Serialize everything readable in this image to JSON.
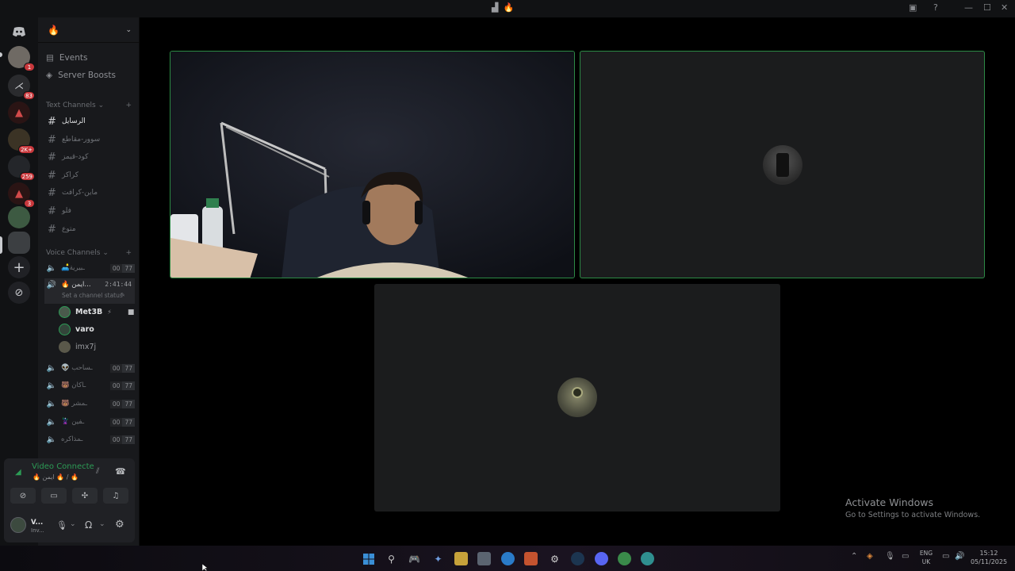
{
  "window": {
    "title_glyph": "🔥",
    "controls": [
      "—",
      "☐",
      "✕"
    ]
  },
  "rail": {
    "badges": [
      "1",
      "83",
      "2K+",
      "259",
      "3"
    ]
  },
  "server": {
    "name_glyph": "🔥",
    "links": [
      {
        "label": "Events",
        "icon": "calendar-icon"
      },
      {
        "label": "Server Boosts",
        "icon": "boost-icon"
      }
    ],
    "text_category": "Text Channels",
    "text_channels": [
      "الرسايل",
      "سوور-مقاطع",
      "كود-قيمز",
      "كراكز",
      "ماين-كرافت",
      "فلو",
      "متوع"
    ],
    "voice_category": "Voice Channels",
    "voice_channels": [
      {
        "name": "🛋️ـبيرية",
        "count_a": "00",
        "count_b": "77"
      },
      {
        "name": "🔥 ايمن...",
        "timer": "2:41:44",
        "status": "Set a channel status"
      },
      {
        "name": "👽 ـساحب",
        "count_a": "00",
        "count_b": "77"
      },
      {
        "name": "🐻 ـاكان",
        "count_a": "00",
        "count_b": "77"
      },
      {
        "name": "🐻 ـمشر",
        "count_a": "00",
        "count_b": "77"
      },
      {
        "name": "🦹 ـفين",
        "count_a": "00",
        "count_b": "77"
      },
      {
        "name": "ـمذاكره",
        "count_a": "00",
        "count_b": "77"
      }
    ],
    "voice_users": [
      "Met3B",
      "varo",
      "imx7j"
    ]
  },
  "voice_panel": {
    "status": "Video Connecte",
    "subtitle": "🔥 ايمن 🔥 / 🔥",
    "user_name": "V...",
    "user_status": "Inv..."
  },
  "stage": {
    "watermark_title": "Activate Windows",
    "watermark_sub": "Go to Settings to activate Windows."
  },
  "taskbar": {
    "lang_top": "ENG",
    "lang_bottom": "UK",
    "time": "15:12",
    "date": "05/11/2025"
  },
  "colors": {
    "speaking_border": "#2c8a45",
    "connected_green": "#2c9b55",
    "badge_red": "#c9383c"
  }
}
